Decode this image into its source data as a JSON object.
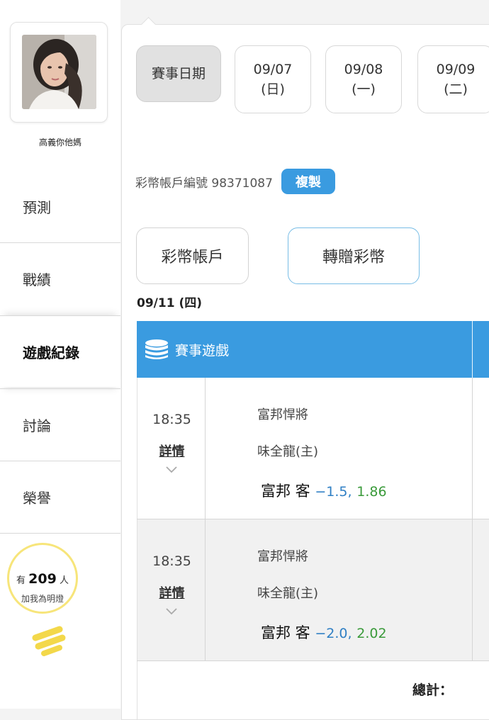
{
  "user": {
    "name": "高義你他媽",
    "avatar_icon": "profile-photo"
  },
  "nav": {
    "items": [
      {
        "label": "預測"
      },
      {
        "label": "戰績"
      },
      {
        "label": "遊戲紀錄"
      },
      {
        "label": "討論"
      },
      {
        "label": "榮譽"
      }
    ],
    "active_index": 2
  },
  "fans": {
    "prefix": "有",
    "count": "209",
    "suffix": "人",
    "label": "加我為明燈",
    "icon": "lightbulb-icon"
  },
  "date_bar": {
    "label": "賽事日期",
    "dates": [
      {
        "date": "09/07",
        "weekday": "(日)"
      },
      {
        "date": "09/08",
        "weekday": "(一)"
      },
      {
        "date": "09/09",
        "weekday": "(二)"
      }
    ]
  },
  "account": {
    "label": "彩幣帳戶編號 98371087",
    "copy_label": "複製"
  },
  "tabs": [
    {
      "label": "彩幣帳戶"
    },
    {
      "label": "轉贈彩幣"
    }
  ],
  "day_label": "09/11 (四)",
  "table": {
    "header_icon": "coins-stack-icon",
    "header_label": "賽事遊戲",
    "rows": [
      {
        "time": "18:35",
        "detail": "詳情",
        "away": "富邦悍將",
        "home": "味全龍(主)",
        "pick": "富邦 客",
        "line": "−1.5,",
        "odds": "1.86"
      },
      {
        "time": "18:35",
        "detail": "詳情",
        "away": "富邦悍將",
        "home": "味全龍(主)",
        "pick": "富邦 客",
        "line": "−2.0,",
        "odds": "2.02"
      }
    ],
    "total_label": "總計："
  },
  "colors": {
    "accent": "#3a9be0",
    "line_blue": "#2f7fc4",
    "odds_green": "#3a9a3a",
    "bulb": "#f7e57a"
  }
}
